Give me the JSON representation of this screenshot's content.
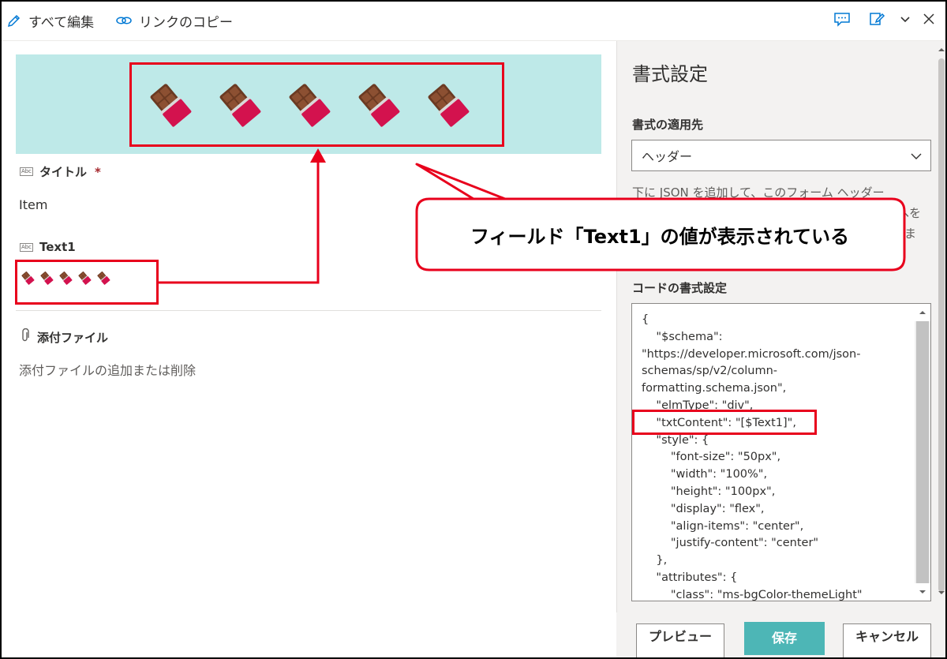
{
  "toolbar": {
    "edit_all": "すべて編集",
    "copy_link": "リンクのコピー"
  },
  "form": {
    "header_icon_count": 5,
    "title_field": {
      "label": "タイトル",
      "required_mark": "*",
      "value": "Item"
    },
    "text1_field": {
      "label": "Text1",
      "icon_count": 5
    },
    "attachments": {
      "label": "添付ファイル",
      "hint": "添付ファイルの追加または削除"
    },
    "field_type_icon": "Abc"
  },
  "pane": {
    "title": "書式設定",
    "apply_to_label": "書式の適用先",
    "apply_to_value": "ヘッダー",
    "description_lines": [
      "下に JSON を追加して、このフォーム ヘッダー"
    ],
    "description_fragments": [
      "へを",
      "ま"
    ],
    "code_label": "コードの書式設定",
    "code_lines": [
      "{",
      "    \"$schema\":",
      "\"https://developer.microsoft.com/json-",
      "schemas/sp/v2/column-",
      "formatting.schema.json\",",
      "    \"elmType\": \"div\",",
      "    \"txtContent\": \"[$Text1]\",",
      "    \"style\": {",
      "        \"font-size\": \"50px\",",
      "        \"width\": \"100%\",",
      "        \"height\": \"100px\",",
      "        \"display\": \"flex\",",
      "        \"align-items\": \"center\",",
      "        \"justify-content\": \"center\"",
      "    },",
      "    \"attributes\": {",
      "        \"class\": \"ms-bgColor-themeLight\""
    ],
    "buttons": {
      "preview": "プレビュー",
      "save": "保存",
      "cancel": "キャンセル"
    }
  },
  "annotation": {
    "callout": "フィールド「Text1」の値が表示されている"
  },
  "colors": {
    "accent": "#4db6b6",
    "banner_bg": "#bee9e8",
    "annotation_red": "#e8001c"
  },
  "icons": [
    "pencil-icon",
    "link-icon",
    "comment-icon",
    "edit-form-icon",
    "chevron-down-icon",
    "close-icon",
    "paperclip-icon",
    "chocolate-bar-icon"
  ]
}
